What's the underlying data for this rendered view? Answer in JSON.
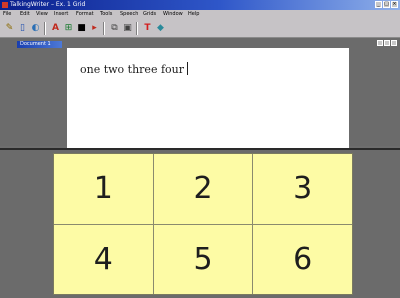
{
  "window": {
    "title": "TalkingWriter – Ex. 1 Grid"
  },
  "menubar": {
    "items": [
      "File",
      "Edit",
      "View",
      "Insert",
      "Format",
      "Tools",
      "Speech",
      "Grids",
      "Window",
      "Help"
    ]
  },
  "document": {
    "tab_title": "Document 1",
    "text": "one two three four"
  },
  "grid": {
    "cells": [
      "1",
      "2",
      "3",
      "4",
      "5",
      "6"
    ]
  }
}
